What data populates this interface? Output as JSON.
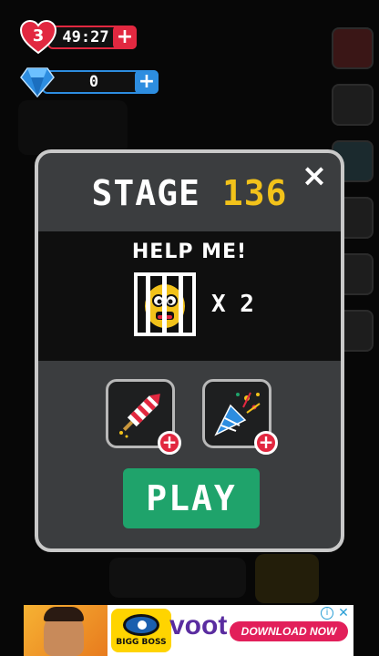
{
  "hud": {
    "lives_count": "3",
    "lives_timer": "49:27",
    "lives_plus": "+",
    "gems_count": "0",
    "gems_plus": "+"
  },
  "dialog": {
    "stage_word": "STAGE",
    "stage_number": "136",
    "close_glyph": "×",
    "mission_title": "HELP ME!",
    "goal_count": "X 2",
    "goal_icon": "caged-face-icon",
    "boosters": [
      {
        "icon": "firework-rocket-icon",
        "add": "+"
      },
      {
        "icon": "party-popper-icon",
        "add": "+"
      }
    ],
    "play_label": "PLAY"
  },
  "ad": {
    "show_label": "BIGG BOSS",
    "brand": "voot",
    "cta": "DOWNLOAD NOW",
    "info_glyph": "i",
    "close_glyph": "✕"
  },
  "colors": {
    "stage_number": "#f2c21a",
    "heart": "#e22840",
    "gem": "#2d8de0",
    "play": "#1fa36b",
    "dialog_bg": "#3b3d3f"
  }
}
